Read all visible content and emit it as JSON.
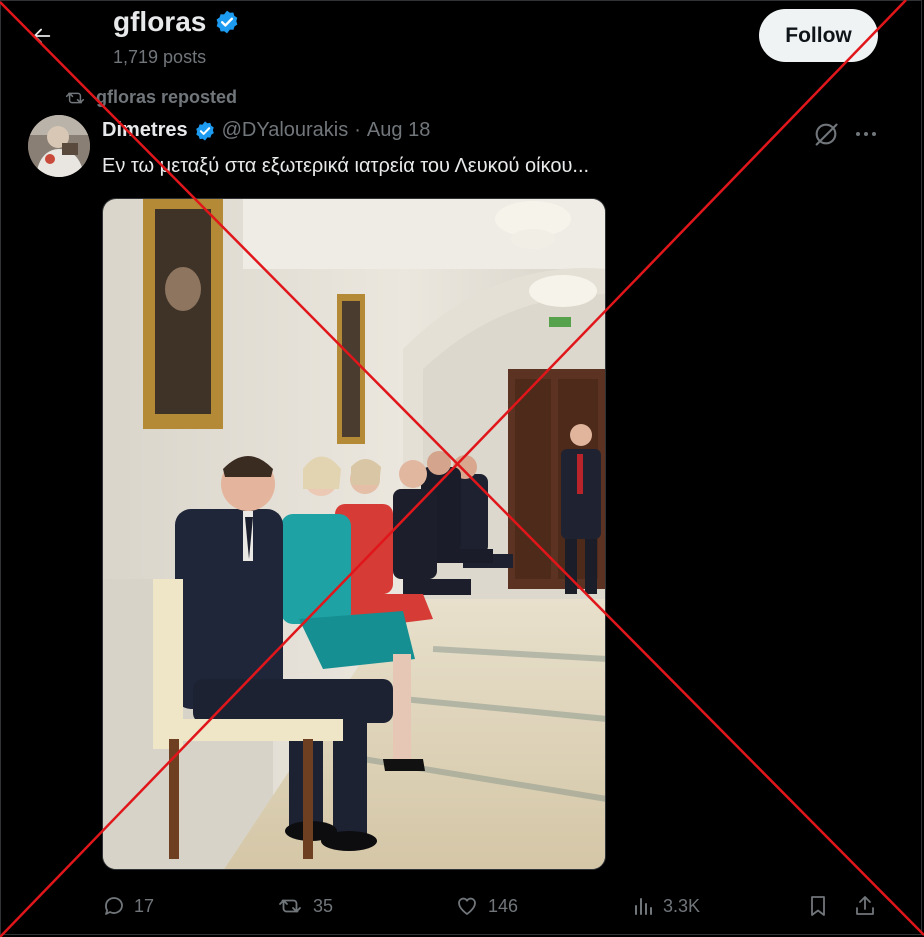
{
  "header": {
    "back_icon": "arrow-left-icon",
    "profile_name": "gfloras",
    "verified_icon": "verified-badge-icon",
    "posts_count": "1,719 posts",
    "follow_label": "Follow"
  },
  "repost": {
    "icon": "repost-icon",
    "text": "gfloras reposted"
  },
  "tweet": {
    "author_name": "Dimetres",
    "handle": "@DYalourakis",
    "separator": "·",
    "date": "Aug 18",
    "text": "Εν τω μεταξύ στα εξωτερικά ιατρεία του Λευκού οίκου...",
    "grok_icon": "grok-icon",
    "more_icon": "more-options-icon"
  },
  "actions": {
    "replies": "17",
    "reposts": "35",
    "likes": "146",
    "views": "3.3K",
    "icons": [
      "reply-icon",
      "repost-icon",
      "heart-icon",
      "analytics-icon",
      "bookmark-icon",
      "share-icon"
    ]
  },
  "overlay": {
    "color": "#e0161b",
    "meaning": "red-x-cross-out"
  },
  "colors": {
    "background": "#000000",
    "text_primary": "#e7e9ea",
    "text_secondary": "#71767b",
    "verified_blue": "#1d9bf0"
  }
}
